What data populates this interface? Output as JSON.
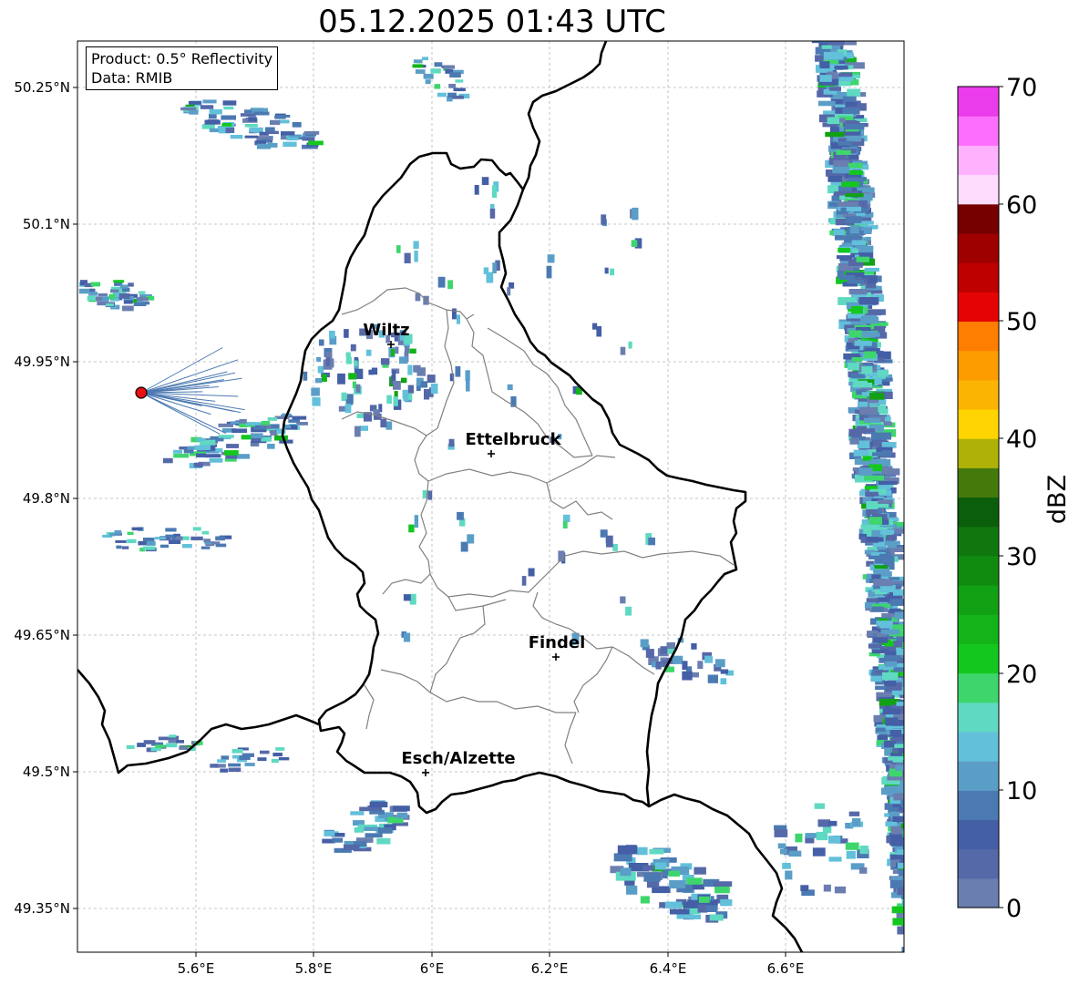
{
  "title": "05.12.2025 01:43 UTC",
  "info": {
    "product": "Product: 0.5° Reflectivity",
    "data": "Data: RMIB"
  },
  "axes": {
    "x_ticks": [
      "5.6°E",
      "5.8°E",
      "6°E",
      "6.2°E",
      "6.4°E",
      "6.6°E"
    ],
    "y_ticks": [
      "50.25°N",
      "50.1°N",
      "49.95°N",
      "49.8°N",
      "49.65°N",
      "49.5°N",
      "49.35°N"
    ]
  },
  "cities": [
    {
      "name": "Wiltz"
    },
    {
      "name": "Ettelbruck"
    },
    {
      "name": "Findel"
    },
    {
      "name": "Esch/Alzette"
    }
  ],
  "colorbar": {
    "label": "dBZ",
    "min": 0,
    "max": 70,
    "step": 2.5,
    "tick_values": [
      "70",
      "60",
      "50",
      "40",
      "30",
      "20",
      "10",
      "0"
    ],
    "colors": [
      "#6a7eb0",
      "#5568a8",
      "#445fa6",
      "#4b79b2",
      "#5a9ec8",
      "#62c0da",
      "#5fd9c2",
      "#3ed66c",
      "#14c71e",
      "#12b41a",
      "#12a015",
      "#108b10",
      "#0f770e",
      "#0b5e0b",
      "#447a0c",
      "#adb108",
      "#ffd400",
      "#fcb402",
      "#fc9c01",
      "#fe7e02",
      "#e50404",
      "#bf0000",
      "#9e0000",
      "#760000",
      "#fedcfe",
      "#feb2fe",
      "#fe6efe",
      "#ea3cea"
    ]
  }
}
